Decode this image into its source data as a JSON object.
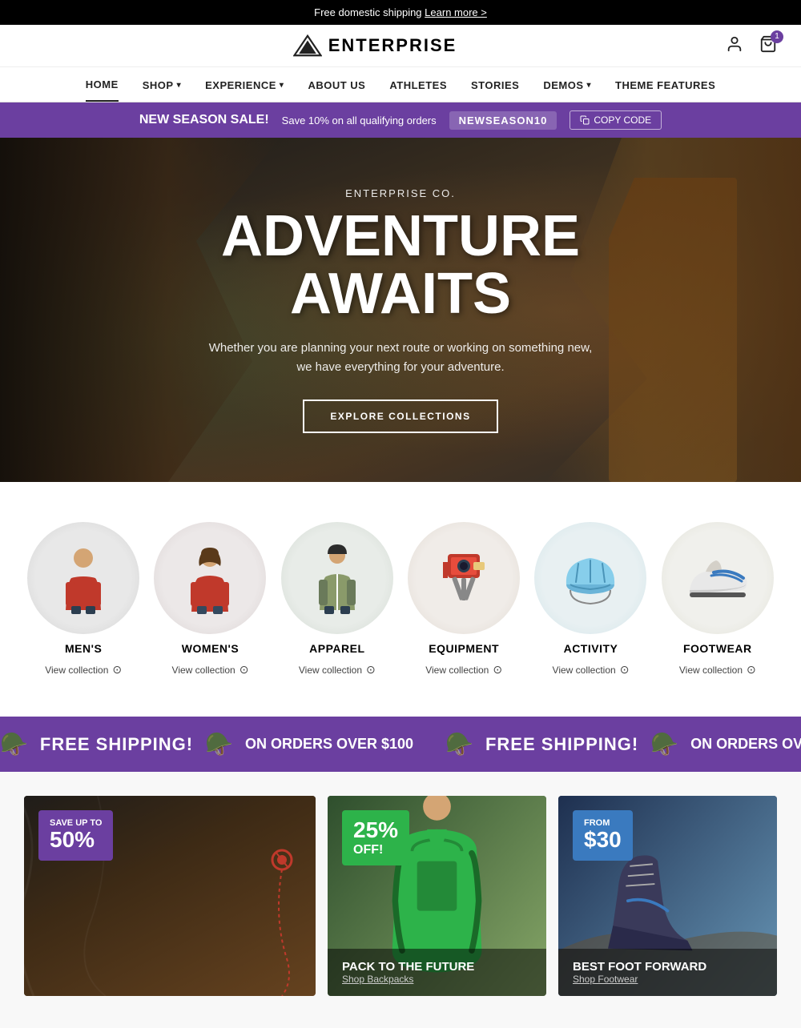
{
  "announcement": {
    "text": "Free domestic shipping",
    "link": "Learn more >"
  },
  "header": {
    "brand": "ENTERPRISE",
    "cart_count": "1"
  },
  "nav": {
    "items": [
      {
        "label": "HOME",
        "active": true,
        "has_dropdown": false
      },
      {
        "label": "SHOP",
        "active": false,
        "has_dropdown": true
      },
      {
        "label": "EXPERIENCE",
        "active": false,
        "has_dropdown": true
      },
      {
        "label": "ABOUT US",
        "active": false,
        "has_dropdown": false
      },
      {
        "label": "ATHLETES",
        "active": false,
        "has_dropdown": false
      },
      {
        "label": "STORIES",
        "active": false,
        "has_dropdown": false
      },
      {
        "label": "DEMOS",
        "active": false,
        "has_dropdown": true
      },
      {
        "label": "THEME FEATURES",
        "active": false,
        "has_dropdown": false
      }
    ]
  },
  "sale_banner": {
    "title": "NEW SEASON SALE!",
    "text": "Save 10% on all qualifying orders",
    "code": "NEWSEASON10",
    "copy_label": "COPY CODE"
  },
  "hero": {
    "subtitle": "ENTERPRISE CO.",
    "title": "ADVENTURE\nAWAITS",
    "description": "Whether you are planning your next route or working on something new, we have everything for your adventure.",
    "cta": "EXPLORE COLLECTIONS"
  },
  "collections": {
    "items": [
      {
        "name": "MEN'S",
        "link": "View collection"
      },
      {
        "name": "WOMEN'S",
        "link": "View collection"
      },
      {
        "name": "APPAREL",
        "link": "View collection"
      },
      {
        "name": "EQUIPMENT",
        "link": "View collection"
      },
      {
        "name": "ACTIVITY",
        "link": "View collection"
      },
      {
        "name": "FOOTWEAR",
        "link": "View collection"
      }
    ]
  },
  "shipping_banner": {
    "main_text": "FREE SHIPPING!",
    "sub_text": "ON ORDERS OVER $100"
  },
  "promos": [
    {
      "badge_top": "SAVE UP TO",
      "badge_amount": "50%",
      "badge_color": "purple",
      "title": "",
      "link": "",
      "size": "large"
    },
    {
      "badge_top": "",
      "badge_amount": "25%",
      "badge_suffix": "OFF!",
      "badge_color": "green",
      "title": "PACK TO THE FUTURE",
      "link": "Shop Backpacks",
      "size": "small"
    },
    {
      "badge_top": "FROM",
      "badge_amount": "$30",
      "badge_color": "blue",
      "title": "BEST FOOT FORWARD",
      "link": "Shop Footwear",
      "size": "small"
    }
  ]
}
